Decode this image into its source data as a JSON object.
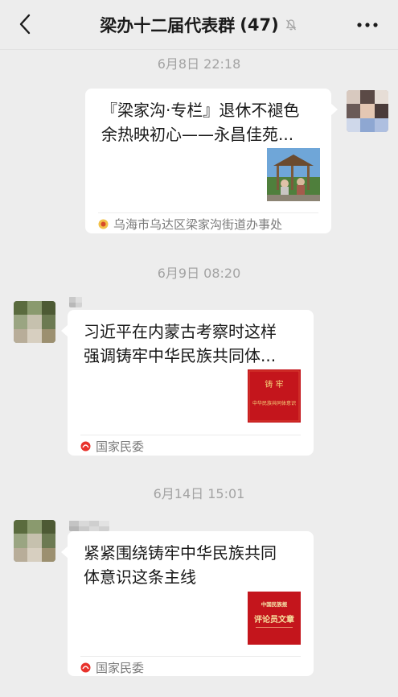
{
  "header": {
    "title": "梁办十二届代表群",
    "member_count": "(47)",
    "back_icon": "chevron-left-icon",
    "more_icon": "more-dots-icon",
    "mute_icon": "mute-bell-icon"
  },
  "messages": [
    {
      "timestamp": "6月8日 22:18",
      "side": "right",
      "title": "『梁家沟·专栏』退休不褪色余热映初心——永昌佳苑...",
      "title_line1": "『梁家沟·专栏』退休不褪色",
      "title_line2": "余热映初心——永昌佳苑...",
      "source": "乌海市乌达区梁家沟街道办事处"
    },
    {
      "timestamp": "6月9日 08:20",
      "side": "left",
      "title": "习近平在内蒙古考察时这样强调铸牢中华民族共同体...",
      "title_line1": "习近平在内蒙古考察时这样",
      "title_line2": "强调铸牢中华民族共同体...",
      "thumb_text_top": "铸 牢",
      "thumb_text_bottom": "中华民族共同体意识",
      "source": "国家民委"
    },
    {
      "timestamp": "6月14日 15:01",
      "side": "left",
      "title": "紧紧围绕铸牢中华民族共同体意识这条主线",
      "title_line1": "紧紧围绕铸牢中华民族共同",
      "title_line2": "体意识这条主线",
      "thumb_text_top": "中国民族报",
      "thumb_text_bottom": "评论员文章",
      "source": "国家民委"
    }
  ],
  "colors": {
    "background": "#ededed",
    "card": "#ffffff",
    "timestamp": "#a3a3a3",
    "source_text": "#7a7a7a",
    "thumb_red": "#c4151c"
  }
}
